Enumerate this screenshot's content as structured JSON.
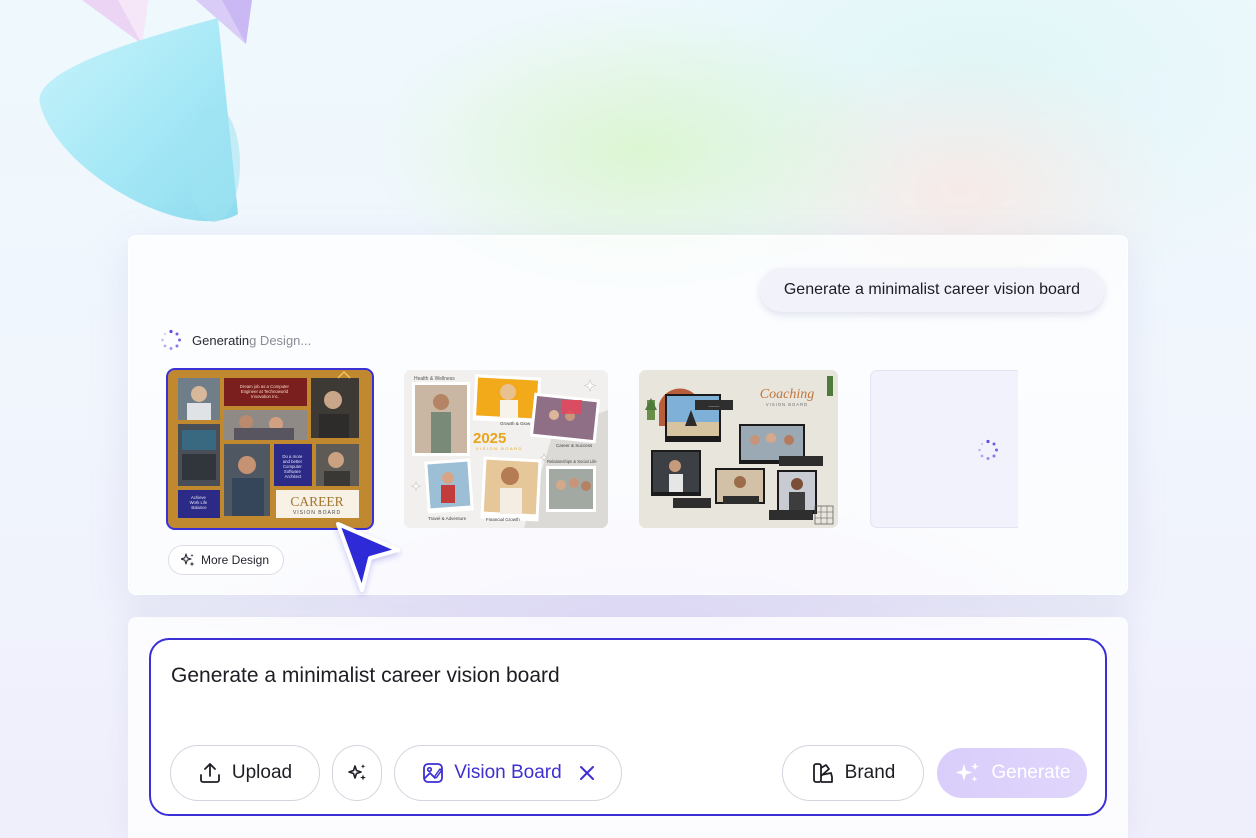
{
  "chat": {
    "user_message": "Generate a minimalist career vision board",
    "status_text": "Generating Design...",
    "more_button": "More Design"
  },
  "thumbnails": {
    "career": {
      "title": "CAREER",
      "subtitle": "VISION BOARD",
      "box1": "Dream job as a Computer Engineer at Technoworld Innovation Inc.",
      "box2": "Do a more and better Computer Software Architect",
      "box3": "Achieve Work Life Balance"
    },
    "twenty_five": {
      "year": "2025",
      "subtitle": "VISION BOARD",
      "label_health": "Health & Wellness",
      "label_growth": "Growth & Glow",
      "label_career": "Career & Success",
      "label_travel": "Travel & Adventure",
      "label_financial": "Financial Growth",
      "label_relationship": "Relationships & Social Life"
    },
    "coaching": {
      "title": "Coaching",
      "subtitle": "VISION BOARD"
    }
  },
  "input": {
    "prompt": "Generate a minimalist career vision board",
    "upload_label": "Upload",
    "tag_label": "Vision Board",
    "brand_label": "Brand",
    "generate_label": "Generate"
  },
  "colors": {
    "accent": "#3b2fd6",
    "generate_bg": "#dccffb",
    "career_board_bg": "#c0892f",
    "career_board_maroon": "#7b1e1e",
    "career_board_navy": "#2b2a86"
  }
}
